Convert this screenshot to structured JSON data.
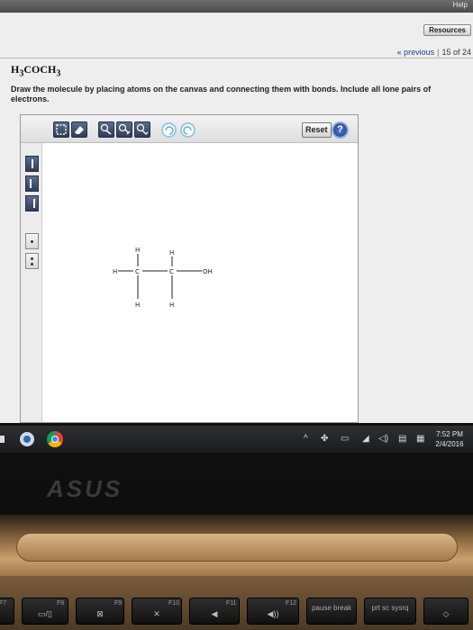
{
  "browser": {
    "help_label": "Help",
    "resources_label": "Resources",
    "previous_label": "« previous",
    "pager_separator": "|",
    "page_counter": "15 of 24"
  },
  "question": {
    "formula_lead": "H",
    "formula_sub1": "3",
    "formula_mid": "COCH",
    "formula_sub2": "3",
    "prompt": "Draw the molecule by placing atoms on the canvas and connecting them with bonds. Include all lone pairs of electrons."
  },
  "sketcher": {
    "reset_label": "Reset",
    "help_label": "?",
    "atoms": {
      "h_top_left": "H",
      "h_top_right": "H",
      "h_left": "H",
      "c_left": "C",
      "c_right": "C",
      "oh": "OH",
      "h_bottom_left": "H",
      "h_bottom_right": "H"
    }
  },
  "taskbar": {
    "time": "7:52 PM",
    "date": "2/4/2016"
  },
  "laptop": {
    "brand": "ASUS",
    "keys": {
      "f7": "F7",
      "f8": "F8",
      "f9": "F9",
      "f10": "F10",
      "f11": "F11",
      "f12": "F12",
      "pause": "pause break",
      "prtsc": "prt sc sysrq"
    }
  },
  "colors": {
    "link": "#1d3f8a",
    "tool_dark": "#2e3d57",
    "tool_circle": "#9cc8e6",
    "help_blue": "#213f86"
  }
}
